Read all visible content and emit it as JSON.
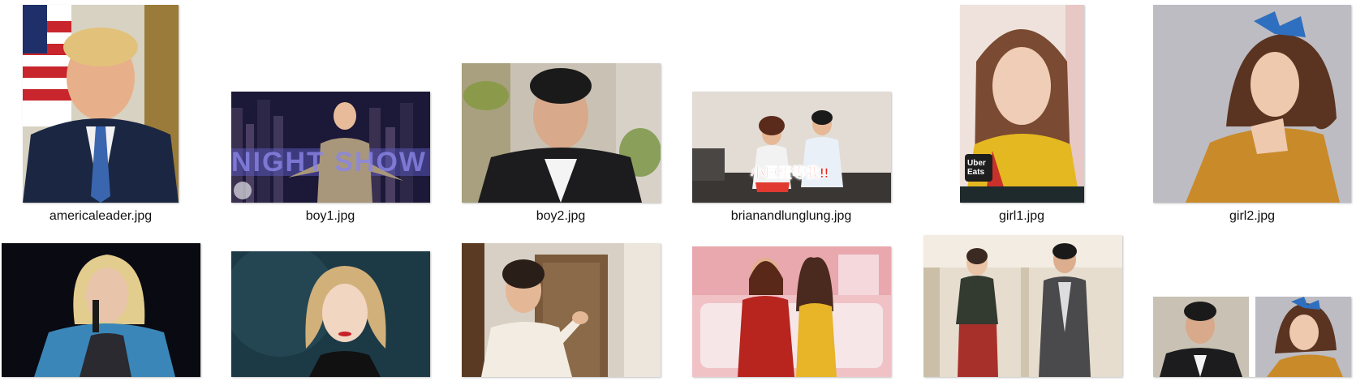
{
  "files": [
    {
      "name": "americaleader.jpg"
    },
    {
      "name": "boy1.jpg",
      "overlay_text": "NIGHT SHOW"
    },
    {
      "name": "boy2.jpg"
    },
    {
      "name": "brianandlunglung.jpg",
      "overlay_text": "小巨蛋等我!!"
    },
    {
      "name": "girl1.jpg",
      "overlay_text": "Uber Eats"
    },
    {
      "name": "girl2.jpg"
    },
    {
      "name": ""
    },
    {
      "name": ""
    },
    {
      "name": ""
    },
    {
      "name": ""
    },
    {
      "name": ""
    },
    {
      "name": ""
    }
  ],
  "colors": {
    "background": "#ffffff",
    "caption": "#111111",
    "uber_green": "#06c167",
    "title_red": "#e8261c"
  }
}
